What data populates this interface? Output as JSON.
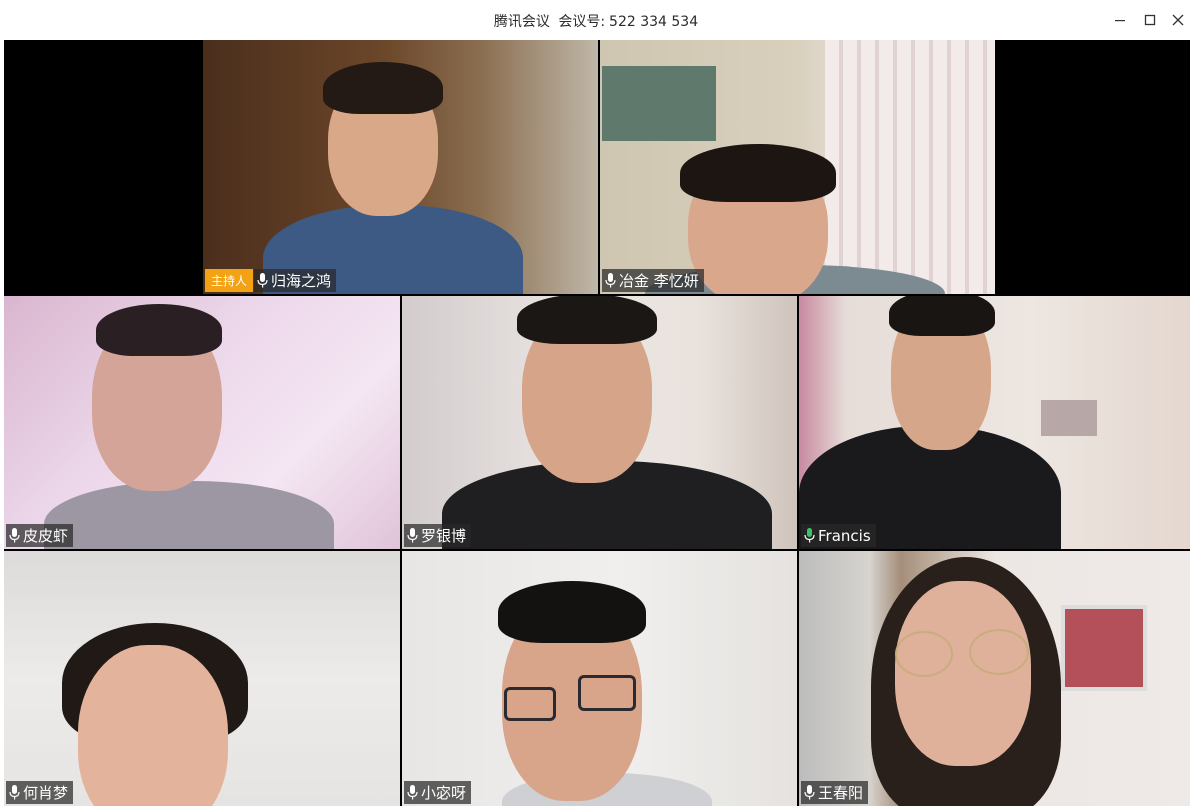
{
  "window": {
    "app_name": "腾讯会议",
    "meeting_label": "会议号:",
    "meeting_id": "522 334 534"
  },
  "colors": {
    "host_badge": "#f2a214",
    "mic_active": "#3cc26a",
    "label_bg": "rgba(40,40,40,0.72)"
  },
  "participants": [
    {
      "name": "归海之鸿",
      "badge": "主持人",
      "mic": "mic-icon"
    },
    {
      "name": "冶金 李忆妍",
      "mic": "mic-icon"
    },
    {
      "name": "皮皮虾",
      "mic": "mic-icon"
    },
    {
      "name": "罗银博",
      "mic": "mic-icon"
    },
    {
      "name": "Francis",
      "mic": "mic-icon-active"
    },
    {
      "name": "何肖梦",
      "mic": "mic-icon"
    },
    {
      "name": "小宓呀",
      "mic": "mic-icon"
    },
    {
      "name": "王春阳",
      "mic": "mic-icon"
    }
  ]
}
